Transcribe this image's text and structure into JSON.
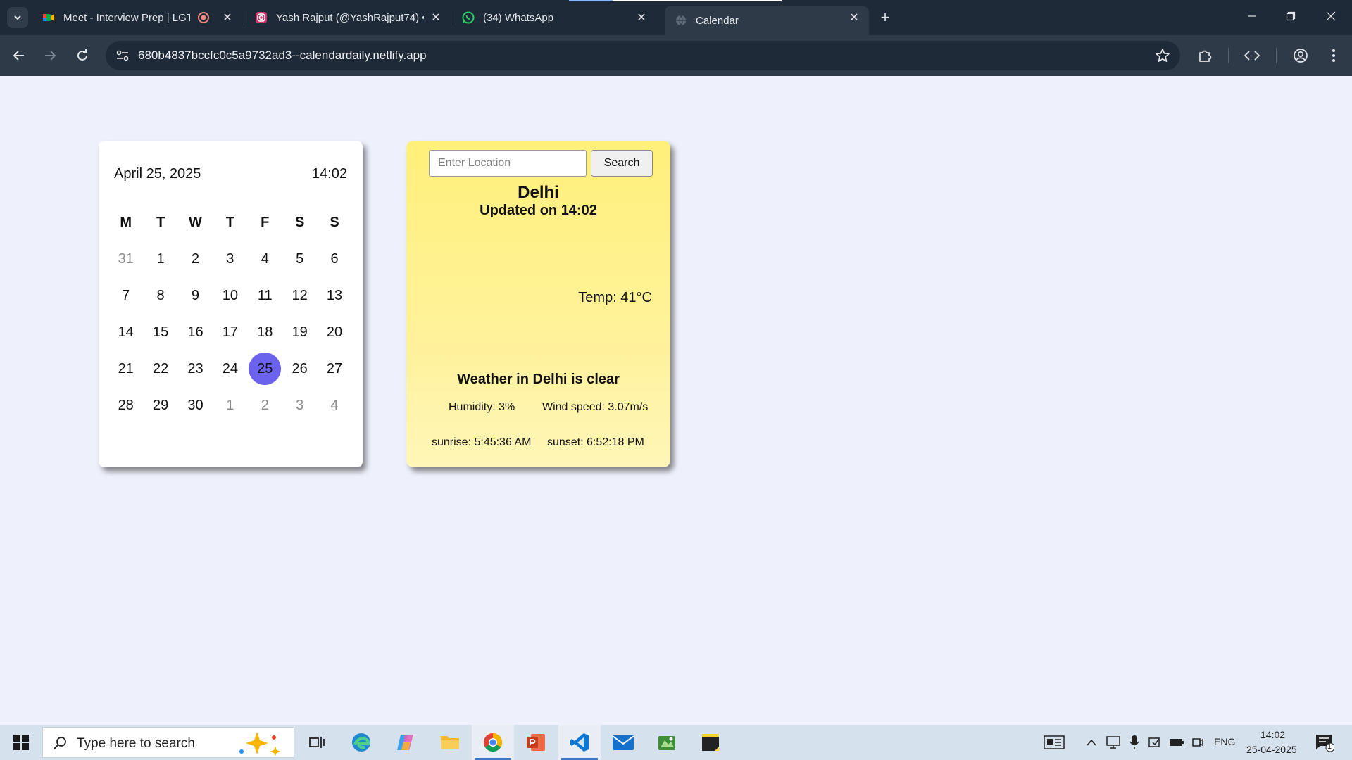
{
  "browser": {
    "tabs": [
      {
        "title": "Meet - Interview Prep | LGT",
        "icon": "google-meet-icon"
      },
      {
        "title": "Yash Rajput (@YashRajput74) •",
        "icon": "instagram-icon"
      },
      {
        "title": "(34) WhatsApp",
        "icon": "whatsapp-icon"
      },
      {
        "title": "Calendar",
        "icon": "globe-icon",
        "active": true
      }
    ],
    "url": "680b4837bccfc0c5a9732ad3--calendardaily.netlify.app"
  },
  "calendar": {
    "date_label": "April 25, 2025",
    "time_label": "14:02",
    "weekdays": [
      "M",
      "T",
      "W",
      "T",
      "F",
      "S",
      "S"
    ],
    "weeks": [
      [
        {
          "d": "31",
          "m": true
        },
        {
          "d": "1"
        },
        {
          "d": "2"
        },
        {
          "d": "3"
        },
        {
          "d": "4"
        },
        {
          "d": "5"
        },
        {
          "d": "6"
        }
      ],
      [
        {
          "d": "7"
        },
        {
          "d": "8"
        },
        {
          "d": "9"
        },
        {
          "d": "10"
        },
        {
          "d": "11"
        },
        {
          "d": "12"
        },
        {
          "d": "13"
        }
      ],
      [
        {
          "d": "14"
        },
        {
          "d": "15"
        },
        {
          "d": "16"
        },
        {
          "d": "17"
        },
        {
          "d": "18"
        },
        {
          "d": "19"
        },
        {
          "d": "20"
        }
      ],
      [
        {
          "d": "21"
        },
        {
          "d": "22"
        },
        {
          "d": "23"
        },
        {
          "d": "24"
        },
        {
          "d": "25",
          "today": true
        },
        {
          "d": "26"
        },
        {
          "d": "27"
        }
      ],
      [
        {
          "d": "28"
        },
        {
          "d": "29"
        },
        {
          "d": "30"
        },
        {
          "d": "1",
          "m": true
        },
        {
          "d": "2",
          "m": true
        },
        {
          "d": "3",
          "m": true
        },
        {
          "d": "4",
          "m": true
        }
      ]
    ],
    "today_color": "#6b63ee"
  },
  "weather": {
    "input_placeholder": "Enter Location",
    "search_label": "Search",
    "city": "Delhi",
    "updated": "Updated on 14:02",
    "temp": "Temp: 41°C",
    "description": "Weather in Delhi is clear",
    "humidity": "Humidity: 3%",
    "wind": "Wind speed: 3.07m/s",
    "sunrise": "sunrise: 5:45:36 AM",
    "sunset": "sunset: 6:52:18 PM",
    "card_color": "#fff07a"
  },
  "taskbar": {
    "search_placeholder": "Type here to search",
    "lang": "ENG",
    "time": "14:02",
    "date": "25-04-2025",
    "notification_count": "1"
  }
}
